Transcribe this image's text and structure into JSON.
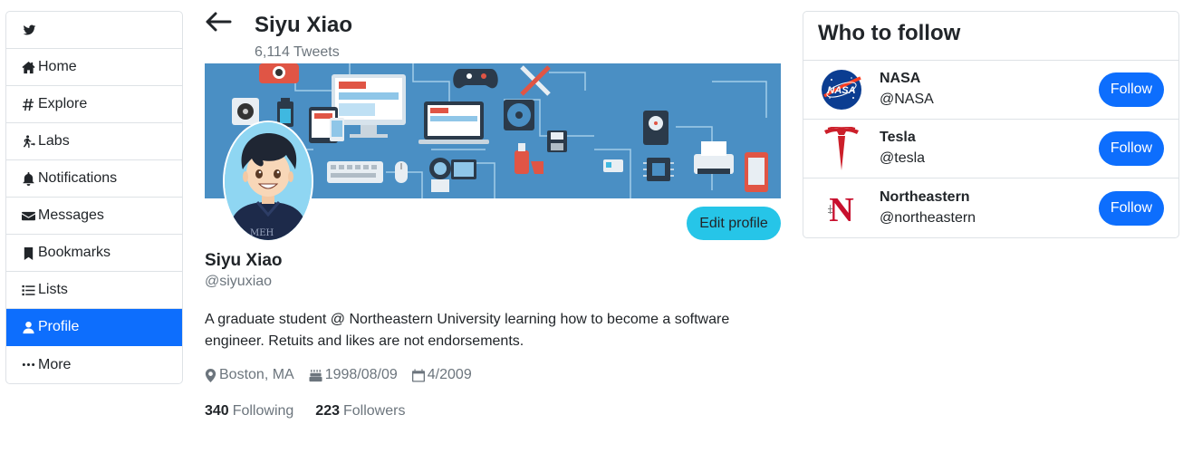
{
  "nav": {
    "items": [
      {
        "label": "",
        "icon": "twitter-icon"
      },
      {
        "label": "Home",
        "icon": "home-icon"
      },
      {
        "label": "Explore",
        "icon": "hashtag-icon"
      },
      {
        "label": "Labs",
        "icon": "person-running-icon"
      },
      {
        "label": "Notifications",
        "icon": "bell-icon"
      },
      {
        "label": "Messages",
        "icon": "envelope-icon"
      },
      {
        "label": "Bookmarks",
        "icon": "bookmark-icon"
      },
      {
        "label": "Lists",
        "icon": "list-icon"
      },
      {
        "label": "Profile",
        "icon": "user-icon",
        "active": true
      },
      {
        "label": "More",
        "icon": "ellipsis-icon"
      }
    ],
    "active_color": "#0d6efd"
  },
  "header": {
    "title": "Siyu Xiao",
    "tweet_count": "6,114 Tweets"
  },
  "profile": {
    "edit_label": "Edit profile",
    "name": "Siyu Xiao",
    "handle": "@siyuxiao",
    "bio": "A graduate student @ Northeastern University learning how to become a software engineer. Retuits and likes are not endorsements.",
    "location": "Boston, MA",
    "birthday": "1998/08/09",
    "joined": "4/2009",
    "following_count": "340",
    "following_label": "Following",
    "followers_count": "223",
    "followers_label": "Followers",
    "avatar_text": "MEH"
  },
  "who_to_follow": {
    "title": "Who to follow",
    "accounts": [
      {
        "name": "NASA",
        "handle": "@NASA",
        "button": "Follow",
        "logo": "nasa-logo",
        "logo_text": "NASA"
      },
      {
        "name": "Tesla",
        "handle": "@tesla",
        "button": "Follow",
        "logo": "tesla-logo"
      },
      {
        "name": "Northeastern",
        "handle": "@northeastern",
        "button": "Follow",
        "logo": "northeastern-logo",
        "logo_text": "N"
      }
    ]
  },
  "colors": {
    "accent": "#0d6efd",
    "edit_button": "#26c5e8",
    "banner": "#4a90c2"
  }
}
